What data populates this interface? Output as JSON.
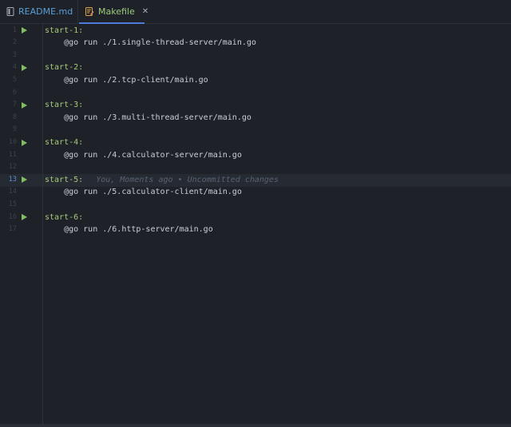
{
  "tabs": [
    {
      "label": "README.md",
      "icon": "document-icon",
      "active": false
    },
    {
      "label": "Makefile",
      "icon": "makefile-icon",
      "active": true
    }
  ],
  "close_glyph": "✕",
  "colors": {
    "background": "#1e2228",
    "target": "#a6c87a",
    "recipe": "#c9ced6",
    "run_icon": "#7fbf5f",
    "active_tab_underline": "#4c7bd9",
    "current_line_number": "#5a8bd6"
  },
  "current_line": 13,
  "lines": [
    {
      "number": "1",
      "target": "start-1",
      "colon": ":",
      "run": true
    },
    {
      "number": "2",
      "recipe": "    @go run ./1.single-thread-server/main.go"
    },
    {
      "number": "3"
    },
    {
      "number": "4",
      "target": "start-2",
      "colon": ":",
      "run": true
    },
    {
      "number": "5",
      "recipe": "    @go run ./2.tcp-client/main.go"
    },
    {
      "number": "6"
    },
    {
      "number": "7",
      "target": "start-3",
      "colon": ":",
      "run": true
    },
    {
      "number": "8",
      "recipe": "    @go run ./3.multi-thread-server/main.go"
    },
    {
      "number": "9"
    },
    {
      "number": "10",
      "target": "start-4",
      "colon": ":",
      "run": true
    },
    {
      "number": "11",
      "recipe": "    @go run ./4.calculator-server/main.go"
    },
    {
      "number": "12"
    },
    {
      "number": "13",
      "target": "start-5",
      "colon": ":",
      "run": true,
      "blame": "You, Moments ago • Uncommitted changes"
    },
    {
      "number": "14",
      "recipe": "    @go run ./5.calculator-client/main.go"
    },
    {
      "number": "15"
    },
    {
      "number": "16",
      "target": "start-6",
      "colon": ":",
      "run": true
    },
    {
      "number": "17",
      "recipe": "    @go run ./6.http-server/main.go"
    }
  ]
}
